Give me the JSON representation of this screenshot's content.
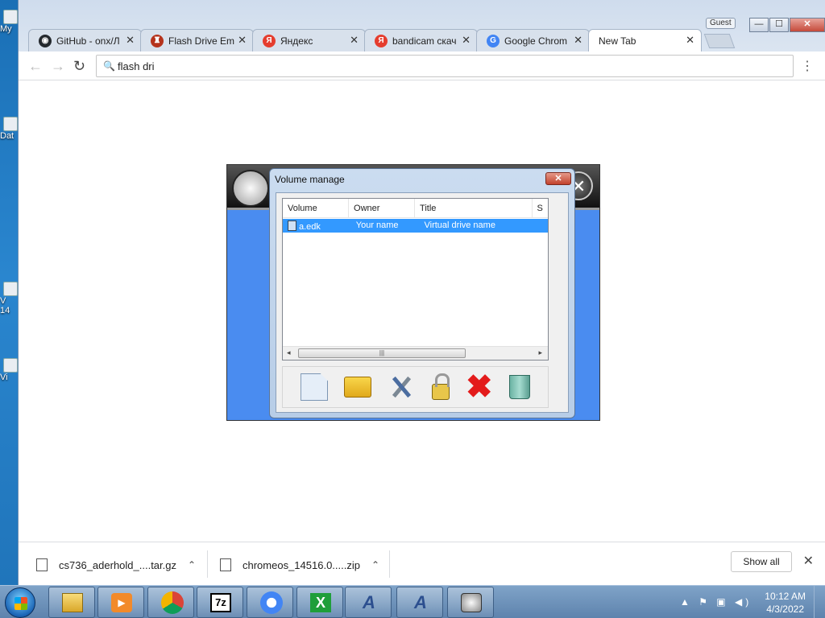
{
  "desktop": {
    "icons": [
      {
        "label": "My"
      },
      {
        "label": "Dat"
      },
      {
        "label": "V"
      },
      {
        "label": "14"
      },
      {
        "label": "Vi"
      }
    ]
  },
  "browser": {
    "profile": "Guest",
    "window_buttons": {
      "minimize": "—",
      "maximize": "☐",
      "close": "✕"
    },
    "tabs": [
      {
        "title": "GitHub - onx/Л",
        "icon": "github-icon",
        "color": "#24292e",
        "glyph": "◉"
      },
      {
        "title": "Flash Drive Em",
        "icon": "shield-icon",
        "color": "#b5331c",
        "glyph": "♜"
      },
      {
        "title": "Яндекс",
        "icon": "yandex-icon",
        "color": "#e53d2e",
        "glyph": "Я"
      },
      {
        "title": "bandicam скач",
        "icon": "yandex-icon",
        "color": "#e53d2e",
        "glyph": "Я"
      },
      {
        "title": "Google Chrom",
        "icon": "google-icon",
        "color": "#4285f4",
        "glyph": "G"
      },
      {
        "title": "New Tab",
        "icon": "none",
        "color": "",
        "glyph": "",
        "active": true
      }
    ],
    "tab_close": "✕",
    "nav": {
      "back": "←",
      "forward": "→",
      "reload": "↻"
    },
    "omnibox": {
      "value": "flash dri",
      "search_glyph": "🔍"
    },
    "menu": "⋮"
  },
  "app": {
    "close_glyph": "✕"
  },
  "dialog": {
    "title": "Volume manage",
    "close_glyph": "✕",
    "columns": [
      "Volume",
      "Owner",
      "Title",
      "S"
    ],
    "rows": [
      {
        "volume": "a.edk",
        "owner": "Your name",
        "title": "Virtual drive name"
      }
    ],
    "scroll": {
      "left": "◂",
      "right": "▸",
      "grip": "|||"
    },
    "toolbar": {
      "new_volume_icon": "document-icon",
      "open_volume_icon": "folder-icon",
      "settings_icon": "tools-icon",
      "unlock_icon": "lock-icon",
      "delete_icon": "delete-icon",
      "delete_glyph": "✖",
      "trash_icon": "trash-icon"
    }
  },
  "downloads": {
    "items": [
      {
        "name": "cs736_aderhold_....tar.gz",
        "caret": "⌃"
      },
      {
        "name": "chromeos_14516.0.....zip",
        "caret": "⌃"
      }
    ],
    "show_all": "Show all",
    "close": "✕"
  },
  "taskbar": {
    "apps": [
      "explorer",
      "media-player",
      "chrome",
      "7zip",
      "chromium",
      "excel",
      "app-a1",
      "app-a2",
      "flash-drive-encryptor"
    ],
    "app_glyphs": [
      "",
      "▶",
      "",
      "7z",
      "",
      "X",
      "A",
      "A",
      ""
    ],
    "tray_icons": "▲ ⚑ ▣ ◀)",
    "time": "10:12 AM",
    "date": "4/3/2022"
  }
}
